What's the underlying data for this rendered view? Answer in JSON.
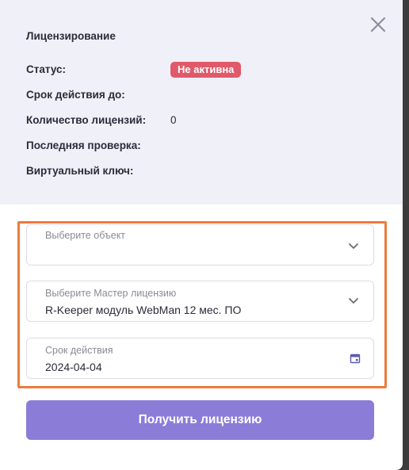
{
  "license": {
    "title": "Лицензирование",
    "status_label": "Статус:",
    "status_value": "Не активна",
    "valid_until_label": "Срок действия до:",
    "count_label": "Количество лицензий:",
    "count_value": "0",
    "last_check_label": "Последняя проверка:",
    "virtual_key_label": "Виртуальный ключ:"
  },
  "form": {
    "object_select": {
      "label": "Выберите объект",
      "value": ""
    },
    "master_select": {
      "label": "Выберите Мастер лицензию",
      "value": "R-Keeper модуль WebMan 12 мес. ПО"
    },
    "duration_field": {
      "label": "Срок действия",
      "value": "2024-04-04"
    }
  },
  "submit_label": "Получить лицензию",
  "colors": {
    "accent": "#8b7cd8",
    "badge_inactive": "#e05a6a",
    "highlight": "#ee7b3a",
    "panel_bg": "#f0f0f8"
  },
  "icons": [
    "close-icon",
    "chevron-down-icon",
    "calendar-icon"
  ]
}
